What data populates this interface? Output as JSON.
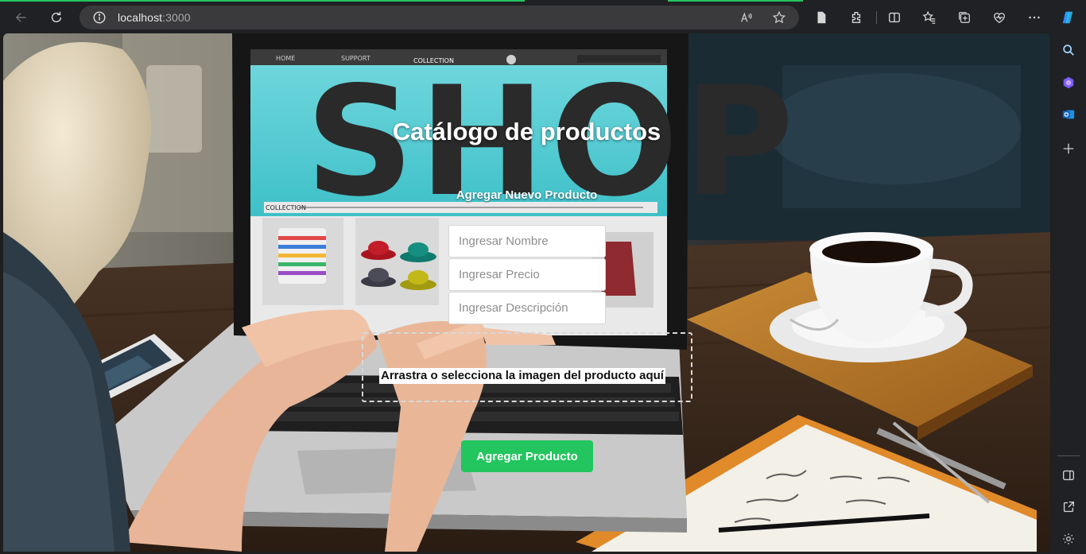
{
  "browser": {
    "url_host": "localhost",
    "url_port": ":3000",
    "icons": [
      "back-icon",
      "reload-icon",
      "info-icon",
      "read-aloud-icon",
      "favorite-star-icon",
      "document-icon",
      "extensions-icon",
      "split-screen-icon",
      "favorites-icon",
      "collections-icon",
      "browser-essentials-icon",
      "more-icon",
      "copilot-icon"
    ],
    "accent": "#22c55e"
  },
  "sidebar": {
    "icons": [
      "search-icon",
      "copilot-sidebar-icon",
      "outlook-icon",
      "add-icon",
      "sidebar-toggle-icon",
      "open-external-icon",
      "settings-icon"
    ]
  },
  "page": {
    "title": "Catálogo de productos",
    "form_title": "Agregar Nuevo Producto",
    "name_placeholder": "Ingresar Nombre",
    "price_placeholder": "Ingresar Precio",
    "description_placeholder": "Ingresar Descripción",
    "dropzone_text": "Arrastra o selecciona la imagen del producto aquí",
    "submit_label": "Agregar Producto",
    "submit_color": "#22c55e"
  },
  "background": {
    "laptop_tabs": [
      "HOME",
      "SUPPORT",
      "COLLECTION"
    ],
    "banner_text": "SHOP",
    "collection_label": "COLLECTION"
  }
}
